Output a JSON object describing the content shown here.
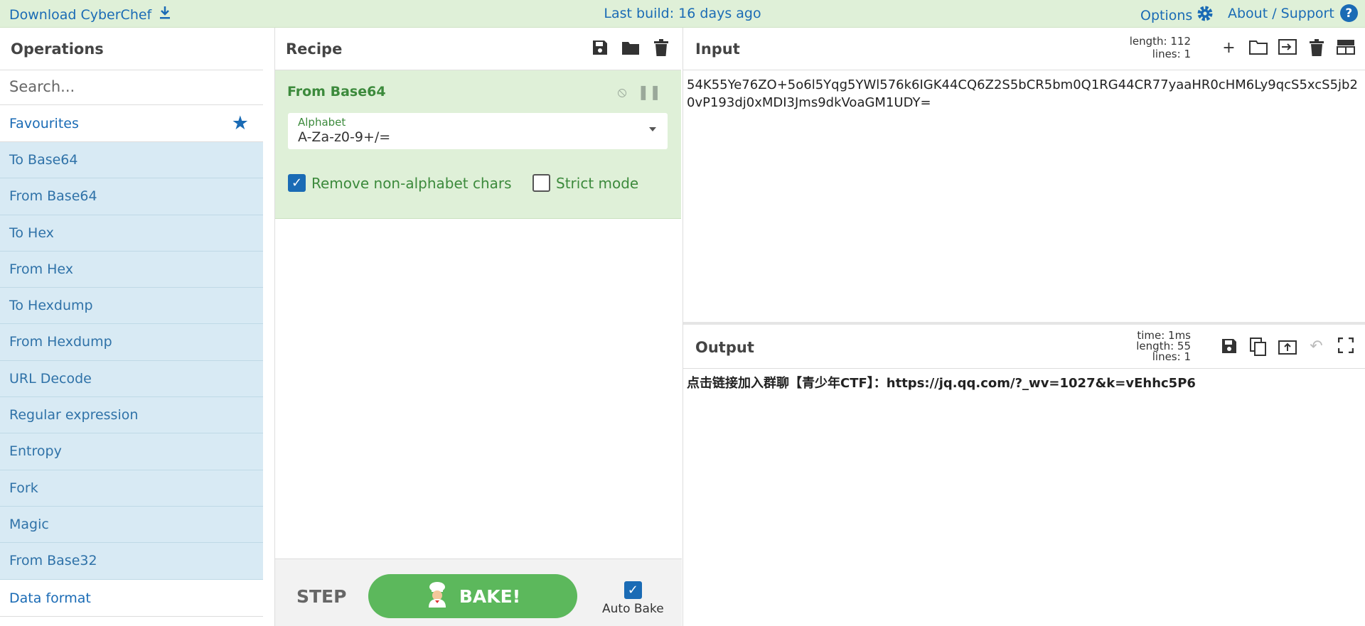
{
  "banner": {
    "download": "Download CyberChef",
    "last_build": "Last build: 16 days ago",
    "options": "Options",
    "about": "About / Support",
    "help": "?"
  },
  "operations": {
    "title": "Operations",
    "search_placeholder": "Search...",
    "favourites": "Favourites",
    "items": [
      "To Base64",
      "From Base64",
      "To Hex",
      "From Hex",
      "To Hexdump",
      "From Hexdump",
      "URL Decode",
      "Regular expression",
      "Entropy",
      "Fork",
      "Magic",
      "From Base32"
    ],
    "data_format": "Data format"
  },
  "recipe": {
    "title": "Recipe",
    "operation": {
      "name": "From Base64",
      "alphabet_label": "Alphabet",
      "alphabet_value": "A-Za-z0-9+/=",
      "remove_non_alpha": "Remove non-alphabet chars",
      "remove_non_alpha_checked": true,
      "strict_mode": "Strict mode",
      "strict_mode_checked": false
    },
    "step": "STEP",
    "bake": "BAKE!",
    "auto_bake": "Auto Bake",
    "auto_bake_checked": true
  },
  "input": {
    "title": "Input",
    "length": "length: 112",
    "lines": "lines:  1",
    "text": "54K55Ye76ZO+5o6l5Yqg5YWl576k6IGK44CQ6Z2S5bCR5bm0Q1RG44CR77yaaHR0cHM6Ly9qcS5xcS5jb20vP193dj0xMDI3Jms9dkVoaGM1UDY="
  },
  "output": {
    "title": "Output",
    "time": "time:  1ms",
    "length": "length:  55",
    "lines": "lines:  1",
    "text": "点击链接加入群聊【青少年CTF】：https://jq.qq.com/?_wv=1027&k=vEhhc5P6"
  }
}
